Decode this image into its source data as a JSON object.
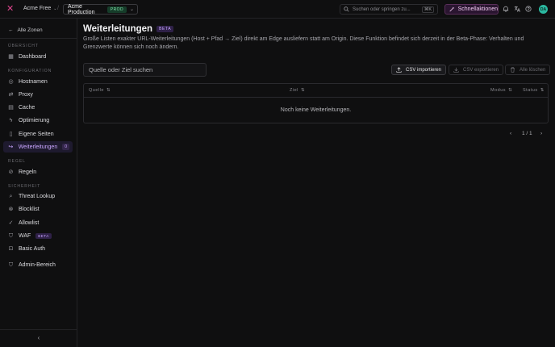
{
  "topbar": {
    "org": "Acme Free",
    "zone": "Acme Production",
    "zone_badge": "PROD",
    "search_placeholder": "Suchen oder springen zu...",
    "search_shortcut": "⌘K",
    "quick_actions": "Schnellaktionen",
    "avatar_initials": "DA"
  },
  "sidebar": {
    "back": "Alle Zonen",
    "sections": {
      "overview": "ÜBERSICHT",
      "config": "KONFIGURATION",
      "rule": "REGEL",
      "security": "SICHERHEIT"
    },
    "items": [
      {
        "label": "Dashboard",
        "icon": "grid-icon"
      },
      {
        "label": "Hostnamen",
        "icon": "globe-icon"
      },
      {
        "label": "Proxy",
        "icon": "arrows-icon"
      },
      {
        "label": "Cache",
        "icon": "database-icon"
      },
      {
        "label": "Optimierung",
        "icon": "bolt-icon"
      },
      {
        "label": "Eigene Seiten",
        "icon": "file-icon"
      },
      {
        "label": "Weiterleitungen",
        "icon": "redirect-icon",
        "badge": "0",
        "active": true
      },
      {
        "label": "Regeln",
        "icon": "filter-icon"
      },
      {
        "label": "Threat Lookup",
        "icon": "search-icon"
      },
      {
        "label": "Blocklist",
        "icon": "ban-icon"
      },
      {
        "label": "Allowlist",
        "icon": "check-circle-icon"
      },
      {
        "label": "WAF",
        "icon": "shield-icon",
        "badge": "BETA"
      },
      {
        "label": "Basic Auth",
        "icon": "lock-icon"
      },
      {
        "label": "Admin-Bereich",
        "icon": "shield-icon"
      }
    ]
  },
  "main": {
    "title": "Weiterleitungen",
    "title_badge": "BETA",
    "description": "Große Listen exakter URL-Weiterleitungen (Host + Pfad → Ziel) direkt am Edge ausliefern statt am Origin. Diese Funktion befindet sich derzeit in der Beta-Phase: Verhalten und Grenzwerte können sich noch ändern.",
    "filter_placeholder": "Quelle oder Ziel suchen",
    "actions": {
      "import": "CSV importieren",
      "export": "CSV exportieren",
      "delete_all": "Alle löschen"
    },
    "columns": [
      "Quelle",
      "Ziel",
      "Modus",
      "Status"
    ],
    "empty": "Noch keine Weiterleitungen.",
    "pagination": "1 / 1"
  },
  "colors": {
    "accent": "#c9a6ff",
    "brand": "#e0458f",
    "background": "#0f0f10"
  }
}
